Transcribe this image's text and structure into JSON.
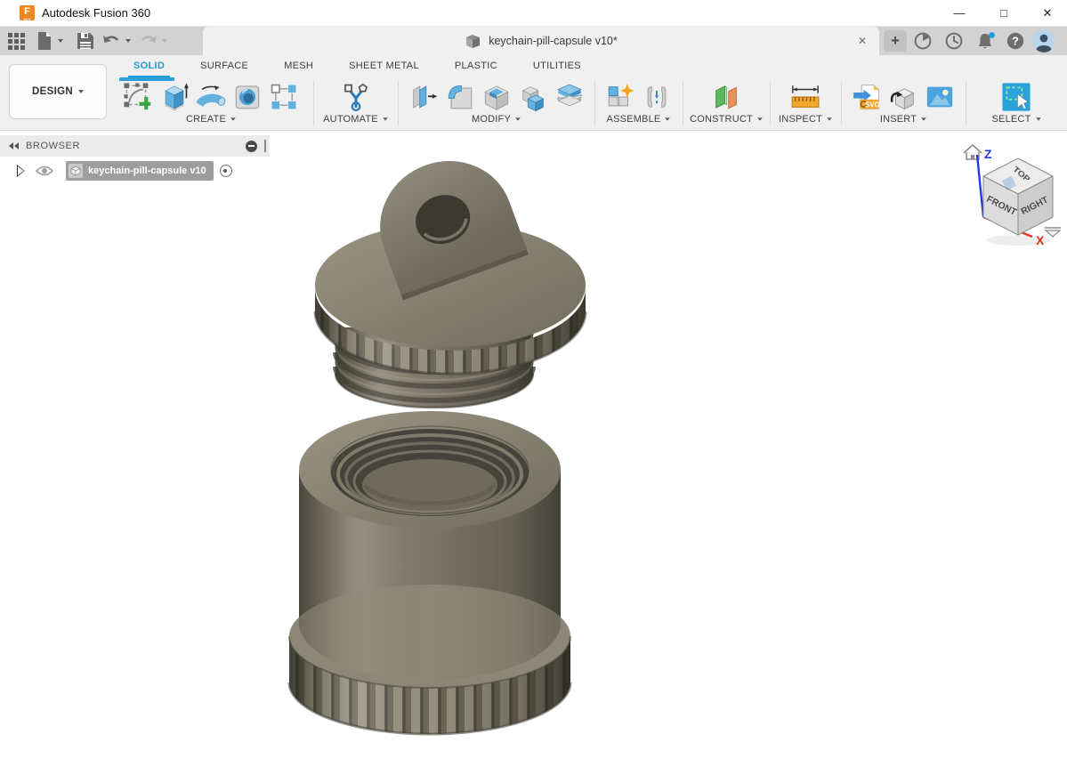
{
  "window": {
    "app_title": "Autodesk Fusion 360",
    "logo_letter": "F",
    "logo_sub": "360",
    "minimize_glyph": "—",
    "maximize_glyph": "□",
    "close_glyph": "✕"
  },
  "quick_access": {
    "new_tab_glyph": "+",
    "tab_close_glyph": "✕",
    "help_glyph": "?"
  },
  "document_tab": {
    "label": "keychain-pill-capsule v10*"
  },
  "ribbon": {
    "design_label": "DESIGN",
    "insert_svg_badge": "SVG",
    "tabs": [
      {
        "label": "SOLID",
        "active": true
      },
      {
        "label": "SURFACE",
        "active": false
      },
      {
        "label": "MESH",
        "active": false
      },
      {
        "label": "SHEET METAL",
        "active": false
      },
      {
        "label": "PLASTIC",
        "active": false
      },
      {
        "label": "UTILITIES",
        "active": false
      }
    ],
    "groups": [
      {
        "label": "CREATE"
      },
      {
        "label": "AUTOMATE"
      },
      {
        "label": "MODIFY"
      },
      {
        "label": "ASSEMBLE"
      },
      {
        "label": "CONSTRUCT"
      },
      {
        "label": "INSPECT"
      },
      {
        "label": "INSERT"
      },
      {
        "label": "SELECT"
      }
    ]
  },
  "browser": {
    "title": "BROWSER",
    "item_label": "keychain-pill-capsule v10"
  },
  "viewcube": {
    "top": "TOP",
    "front": "FRONT",
    "right": "RIGHT",
    "axis_x": "X",
    "axis_z": "Z"
  },
  "colors": {
    "accent_blue": "#1f9cd9",
    "model_olive": "#7b7667",
    "axis_x_red": "#e43425",
    "axis_z_blue": "#1a3bdc",
    "notification_dot": "#1f9cd9",
    "logo_orange": "#f0861f"
  }
}
